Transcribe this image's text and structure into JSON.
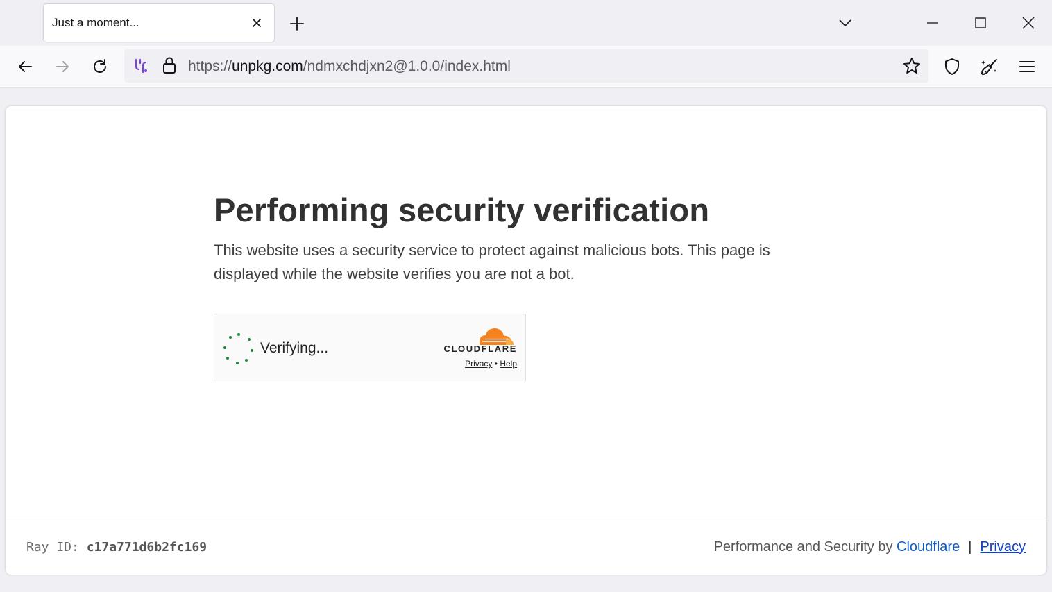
{
  "browser": {
    "tab_title": "Just a moment...",
    "url": {
      "scheme": "https://",
      "host": "unpkg.com",
      "path": "/ndmxchdjxn2@1.0.0/index.html"
    }
  },
  "page": {
    "heading": "Performing security verification",
    "description": "This website uses a security service to protect against malicious bots. This page is displayed while the website verifies you are not a bot.",
    "widget": {
      "status": "Verifying...",
      "brand": "CLOUDFLARE",
      "privacy": "Privacy",
      "separator": "•",
      "help": "Help"
    },
    "footer": {
      "ray_label": "Ray ID:",
      "ray_id": "c17a771d6b2fc169",
      "performance_text": "Performance and Security by",
      "cloudflare_link": "Cloudflare",
      "divider": "|",
      "privacy_link": "Privacy"
    }
  },
  "icons": [
    "close-icon",
    "plus-icon",
    "chevron-down-icon",
    "minimize-icon",
    "maximize-icon",
    "window-close-icon",
    "back-icon",
    "forward-icon",
    "reload-icon",
    "extension-icon",
    "lock-icon",
    "star-icon",
    "shield-icon",
    "broom-icon",
    "menu-icon",
    "spinner-icon",
    "cloudflare-logo"
  ],
  "colors": {
    "heading": "#313131",
    "cloudflare_orange": "#f6821f",
    "spinner_green": "#1b8a3a",
    "link_blue": "#0f5cc0"
  }
}
